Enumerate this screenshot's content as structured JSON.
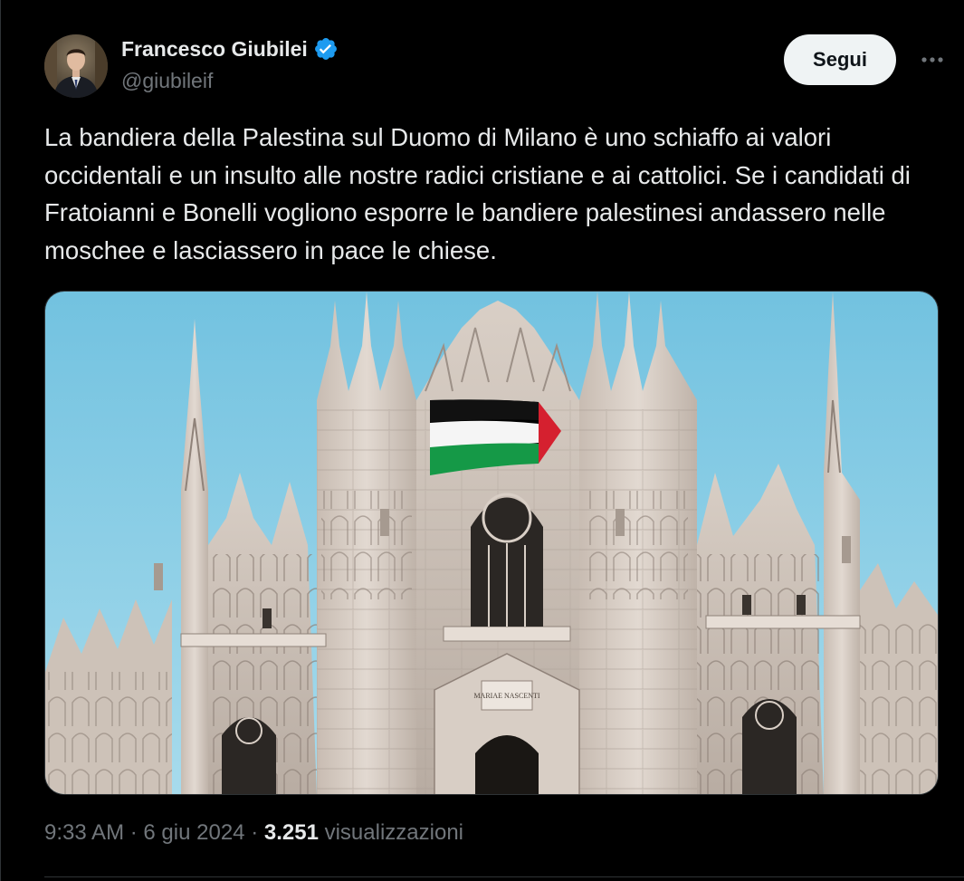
{
  "author": {
    "display_name": "Francesco Giubilei",
    "handle": "@giubileif",
    "verified": true,
    "verified_color": "#1d9bf0"
  },
  "actions": {
    "follow_label": "Segui",
    "more_icon": "more-horizontal-icon"
  },
  "tweet": {
    "text": "La bandiera della Palestina sul Duomo di Milano è uno schiaffo ai valori occidentali e un insulto alle nostre radici cristiane e ai cattolici. Se i candidati di Fratoianni e Bonelli vogliono esporre le bandiere palestinesi andassero nelle moschee e lasciassero in pace le chiese.",
    "media": {
      "inscription": "MARIAE NASCENTI"
    }
  },
  "meta": {
    "time": "9:33 AM",
    "separator": "·",
    "date": "6 giu 2024",
    "views_count": "3.251",
    "views_label": "visualizzazioni"
  },
  "colors": {
    "background": "#000000",
    "text_primary": "#e7e9ea",
    "text_secondary": "#71767b",
    "border": "#2f3336",
    "follow_bg": "#eff3f4"
  }
}
